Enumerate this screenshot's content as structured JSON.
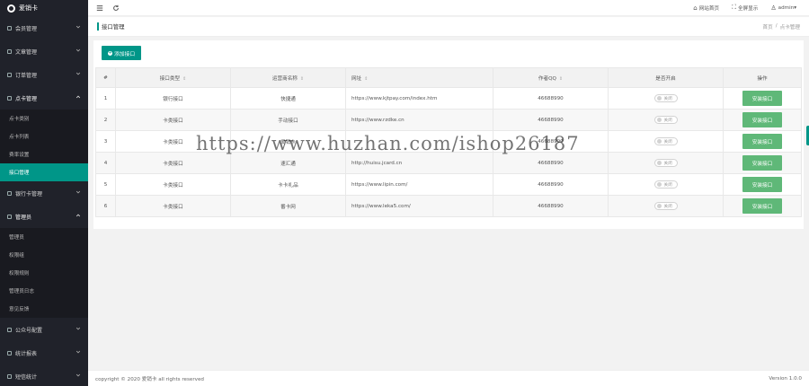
{
  "sidebar": {
    "brand": "爱销卡",
    "groups": [
      {
        "label": "会员管理"
      },
      {
        "label": "文章管理"
      },
      {
        "label": "订单管理"
      },
      {
        "label": "点卡管理",
        "items": [
          "点卡类别",
          "点卡列表",
          "费率设置",
          "接口管理"
        ],
        "active": "接口管理"
      },
      {
        "label": "银行卡管理"
      },
      {
        "label": "管理员",
        "items": [
          "管理员",
          "权限组",
          "权限规则",
          "管理员日志",
          "意见反馈"
        ]
      },
      {
        "label": "公众号配置"
      },
      {
        "label": "统计报表"
      },
      {
        "label": "短信统计"
      }
    ]
  },
  "topbar": {
    "site_home": "网站首页",
    "fullscreen": "全屏显示",
    "user": "admin"
  },
  "breadcrumb": {
    "title": "接口管理",
    "home": "首页",
    "sep": "/",
    "current": "点卡管理"
  },
  "toolbar": {
    "add_label": "添加接口"
  },
  "table": {
    "headers": [
      "#",
      "接口类型",
      "运营商名称",
      "网址",
      "作者QQ",
      "是否开启",
      "操作"
    ],
    "toggle_label": "关闭",
    "action_label": "安装接口",
    "rows": [
      {
        "id": "1",
        "type": "银行接口",
        "name": "快捷通",
        "url": "https://www.kjtpay.com/index.htm",
        "qq": "46688990"
      },
      {
        "id": "2",
        "type": "卡类接口",
        "name": "手动接口",
        "url": "https://www.rzdke.cn",
        "qq": "46688990"
      },
      {
        "id": "3",
        "type": "卡类接口",
        "name": "爱销卡",
        "url": "",
        "qq": "46688990"
      },
      {
        "id": "4",
        "type": "卡类接口",
        "name": "速汇通",
        "url": "http://huisu.jcard.cn",
        "qq": "46688990"
      },
      {
        "id": "5",
        "type": "卡类接口",
        "name": "卡卡礼品",
        "url": "https://www.lipin.com/",
        "qq": "46688990"
      },
      {
        "id": "6",
        "type": "卡类接口",
        "name": "番卡网",
        "url": "https://www.leka5.com/",
        "qq": "46688990"
      }
    ]
  },
  "footer": {
    "copyright": "copyright © 2020 爱销卡 all rights reserved",
    "version": "Version 1.0.0"
  },
  "watermark": "https://www.huzhan.com/ishop26187",
  "colors": {
    "accent": "#009688",
    "sidebar_bg": "#20222a",
    "install_btn": "#5fb878"
  }
}
